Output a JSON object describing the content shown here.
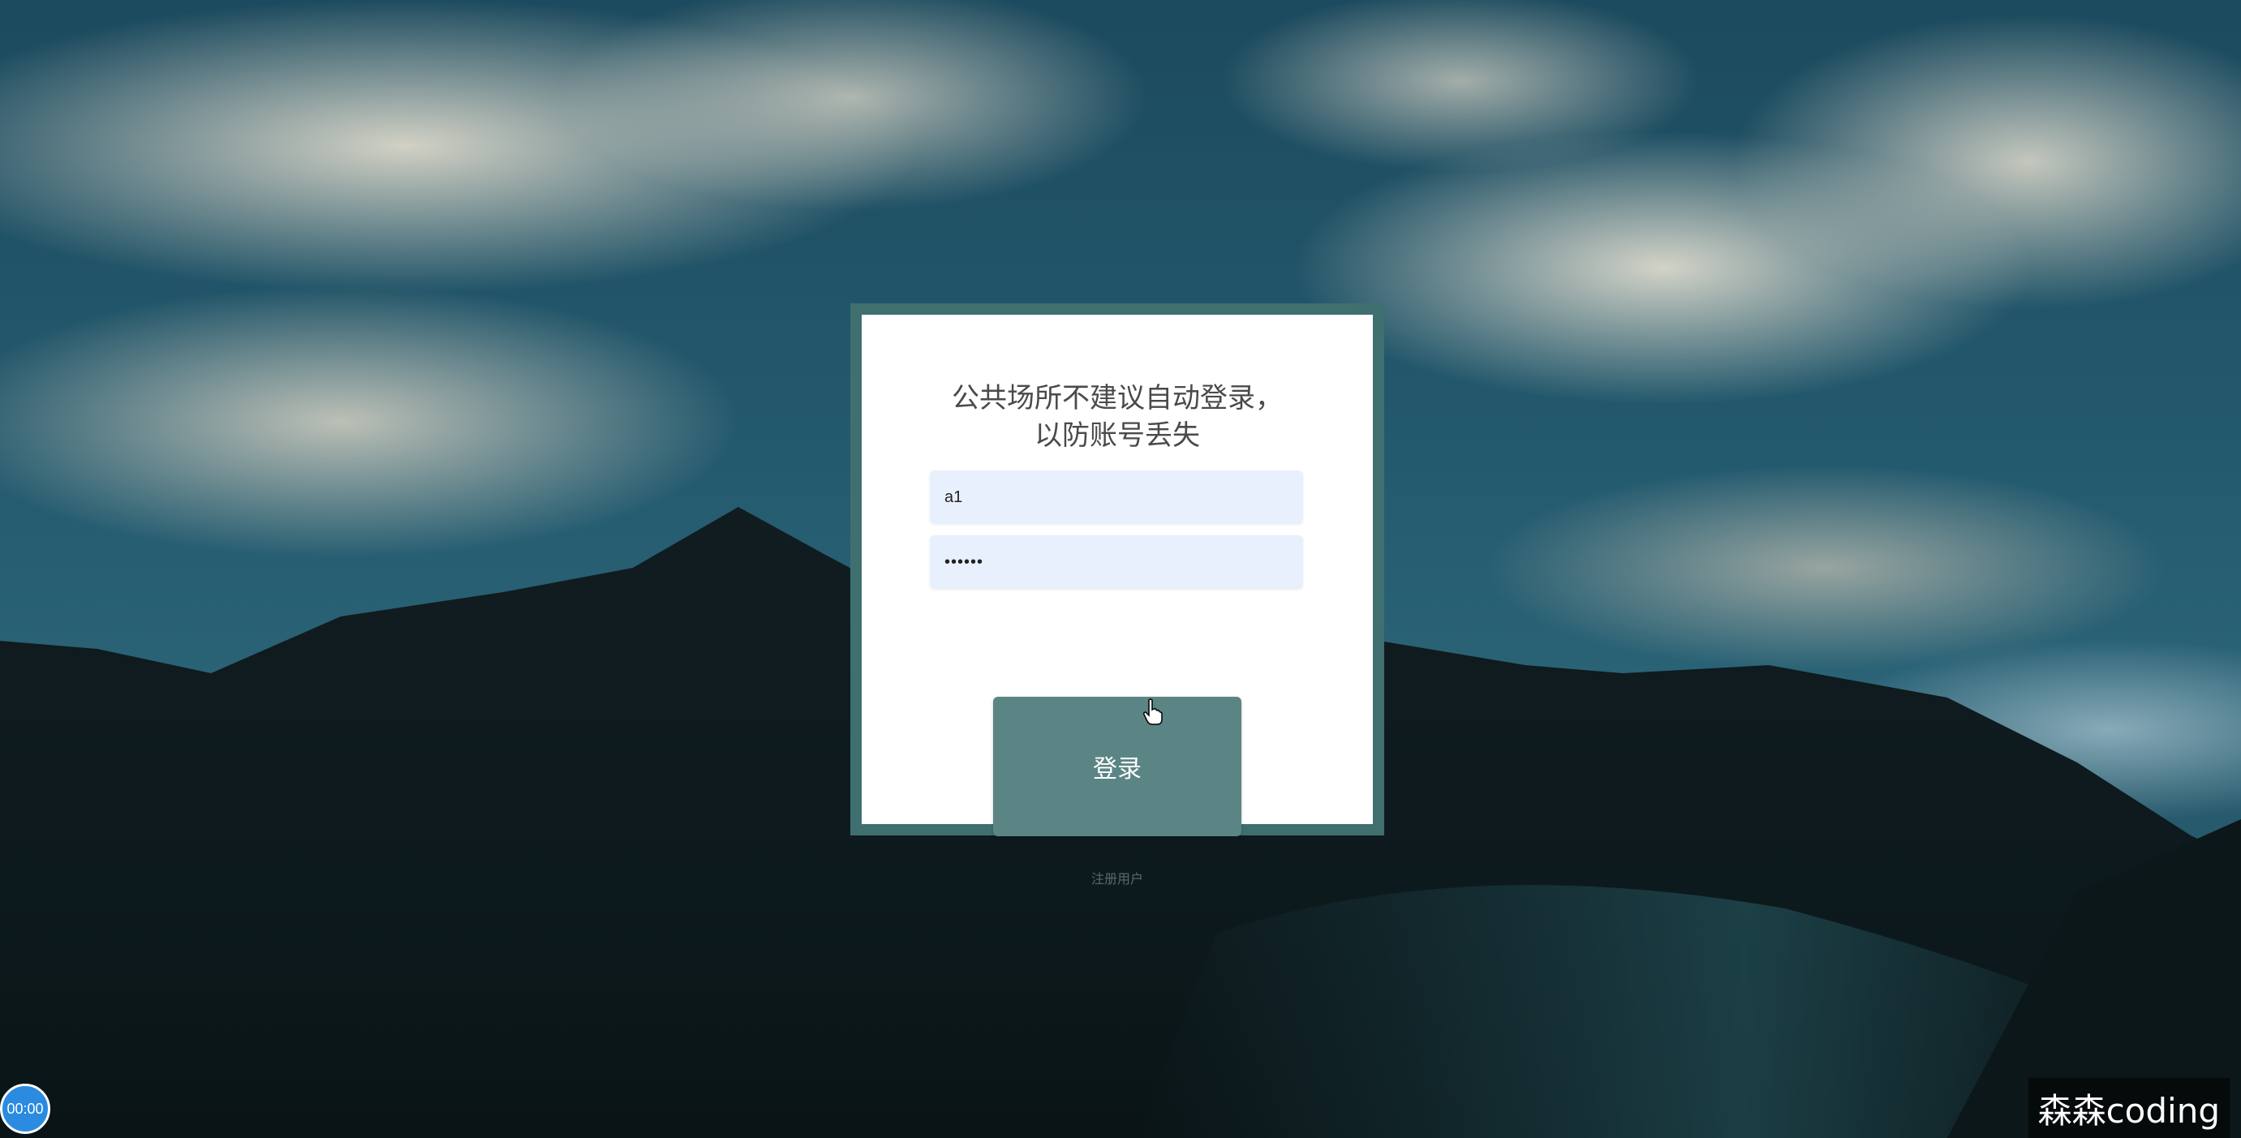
{
  "login": {
    "title_line1": "公共场所不建议自动登录，",
    "title_line2": "以防账号丢失",
    "username_value": "a1",
    "password_value": "••••••",
    "submit_label": "登录",
    "register_label": "注册用户"
  },
  "overlay": {
    "timer": "00:00",
    "watermark": "森森coding"
  },
  "colors": {
    "card_border": "#3f6f6f",
    "button": "#5b8585",
    "input_bg": "#e8f0fe",
    "timer": "#2a8be0"
  }
}
